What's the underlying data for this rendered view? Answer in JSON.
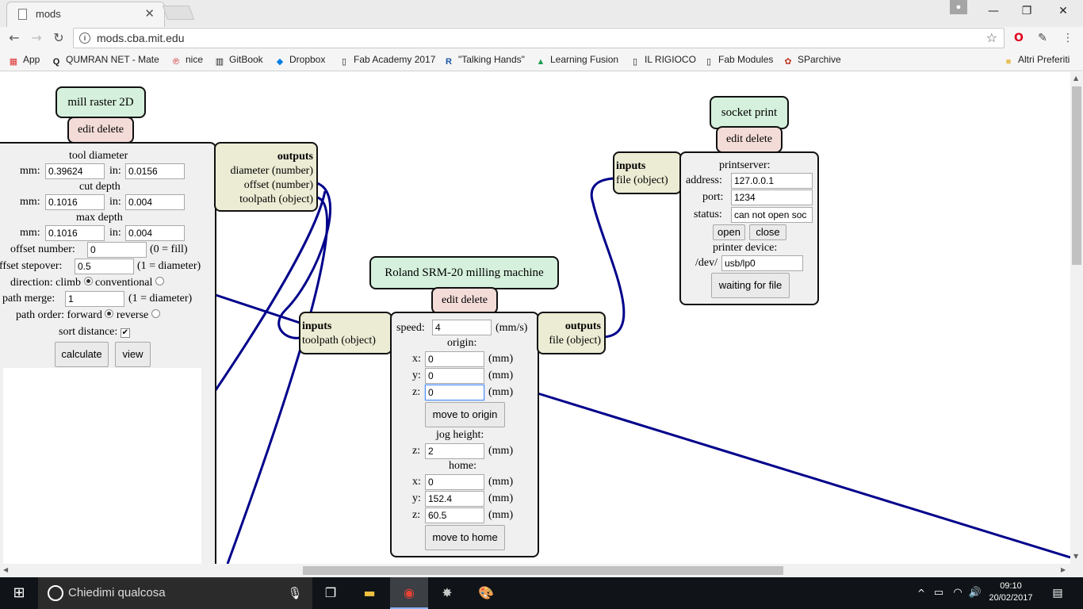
{
  "browser": {
    "tab_title": "mods",
    "url": "mods.cba.mit.edu",
    "bookmarks": [
      {
        "label": "App"
      },
      {
        "label": "QUMRAN NET - Mate"
      },
      {
        "label": "nice"
      },
      {
        "label": "GitBook"
      },
      {
        "label": "Dropbox"
      },
      {
        "label": "Fab Academy 2017"
      },
      {
        "label": "\"Talking Hands\""
      },
      {
        "label": "Learning Fusion"
      },
      {
        "label": "IL RIGIOCO"
      },
      {
        "label": "Fab Modules"
      },
      {
        "label": "SParchive"
      }
    ],
    "other_bookmarks": "Altri Preferiti"
  },
  "mill": {
    "name": "mill raster 2D",
    "edit_delete": "edit delete",
    "tool_diameter": "tool diameter",
    "mm_label": "mm:",
    "in_label": "in:",
    "tool_mm": "0.39624",
    "tool_in": "0.0156",
    "cut_depth": "cut depth",
    "cut_mm": "0.1016",
    "cut_in": "0.004",
    "max_depth": "max depth",
    "max_mm": "0.1016",
    "max_in": "0.004",
    "offset_number_label": "offset number:",
    "offset_number": "0",
    "offset_number_hint": "(0 = fill)",
    "stepover_label": "offset stepover:",
    "stepover": "0.5",
    "stepover_hint": "(1 = diameter)",
    "direction_label": "direction: climb",
    "conventional": "conventional",
    "merge_label": "path merge:",
    "merge": "1",
    "merge_hint": "(1 = diameter)",
    "order_label": "path order: forward",
    "reverse": "reverse",
    "sort_label": "sort distance:",
    "calculate": "calculate",
    "view": "view",
    "outputs_title": "outputs",
    "out_diameter": "diameter (number)",
    "out_offset": "offset (number)",
    "out_toolpath": "toolpath (object)"
  },
  "roland": {
    "name": "Roland SRM-20 milling machine",
    "edit_delete": "edit delete",
    "inputs_title": "inputs",
    "in_toolpath": "toolpath (object)",
    "outputs_title": "outputs",
    "out_file": "file (object)",
    "speed_label": "speed:",
    "speed": "4",
    "speed_unit": "(mm/s)",
    "origin_label": "origin:",
    "x_label": "x:",
    "y_label": "y:",
    "z_label": "z:",
    "mm_unit": "(mm)",
    "origin_x": "0",
    "origin_y": "0",
    "origin_z": "0",
    "move_origin": "move to origin",
    "jog_label": "jog height:",
    "jog_z": "2",
    "home_label": "home:",
    "home_x": "0",
    "home_y": "152.4",
    "home_z": "60.5",
    "move_home": "move to home"
  },
  "socket": {
    "name": "socket print",
    "edit_delete": "edit delete",
    "inputs_title": "inputs",
    "in_file": "file (object)",
    "printserver": "printserver:",
    "address_label": "address:",
    "address": "127.0.0.1",
    "port_label": "port:",
    "port": "1234",
    "status_label": "status:",
    "status": "can not open soc",
    "open": "open",
    "close": "close",
    "device_label": "printer device:",
    "dev_prefix": "/dev/",
    "device": "usb/lp0",
    "waiting": "waiting for file"
  },
  "taskbar": {
    "search_placeholder": "Chiedimi qualcosa",
    "time": "09:10",
    "date": "20/02/2017"
  },
  "colors": {
    "wire": "#00008b",
    "module_name_bg": "#d5f0dc",
    "button_bg": "#f3dcd8",
    "port_bg": "#ececd4",
    "body_bg": "#f0f0f0"
  }
}
